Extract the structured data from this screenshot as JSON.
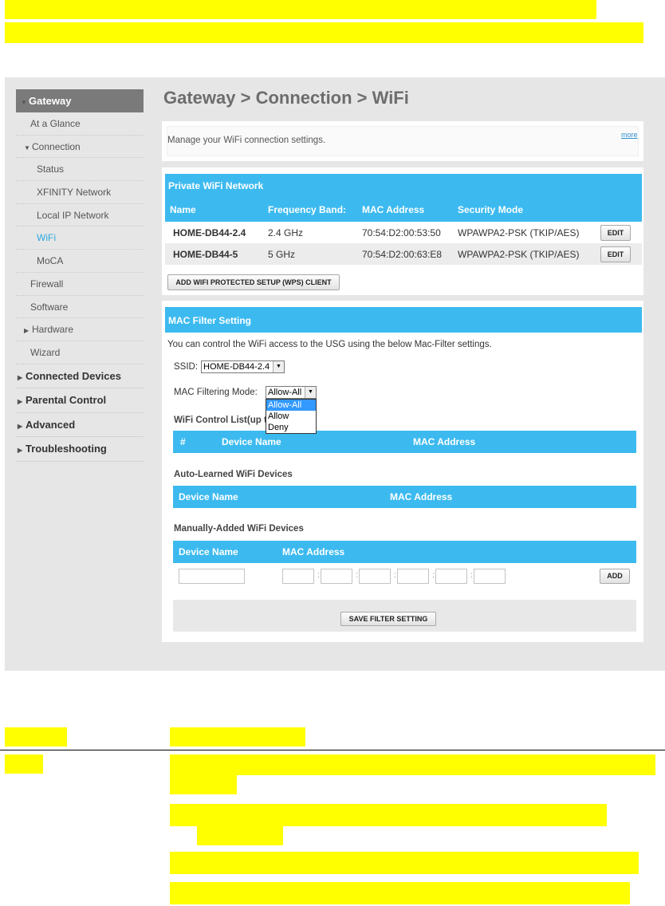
{
  "breadcrumb": "Gateway > Connection > WiFi",
  "sidebar": {
    "section": "Gateway",
    "items": [
      {
        "label": "At a Glance"
      },
      {
        "label": "Connection"
      },
      {
        "label": "Status"
      },
      {
        "label": "XFINITY Network"
      },
      {
        "label": "Local IP Network"
      },
      {
        "label": "WiFi"
      },
      {
        "label": "MoCA"
      },
      {
        "label": "Firewall"
      },
      {
        "label": "Software"
      },
      {
        "label": "Hardware"
      },
      {
        "label": "Wizard"
      }
    ],
    "top_items": [
      {
        "label": "Connected Devices"
      },
      {
        "label": "Parental Control"
      },
      {
        "label": "Advanced"
      },
      {
        "label": "Troubleshooting"
      }
    ]
  },
  "intro": {
    "text": "Manage your WiFi connection settings.",
    "more": "more"
  },
  "private_wifi": {
    "title": "Private WiFi Network",
    "columns": [
      "Name",
      "Frequency Band:",
      "MAC Address",
      "Security Mode"
    ],
    "rows": [
      {
        "name": "HOME-DB44-2.4",
        "band": "2.4 GHz",
        "mac": "70:54:D2:00:53:50",
        "security": "WPAWPA2-PSK (TKIP/AES)",
        "edit": "EDIT"
      },
      {
        "name": "HOME-DB44-5",
        "band": "5 GHz",
        "mac": "70:54:D2:00:63:E8",
        "security": "WPAWPA2-PSK (TKIP/AES)",
        "edit": "EDIT"
      }
    ],
    "wps_button": "ADD WIFI PROTECTED SETUP (WPS) CLIENT"
  },
  "mac_filter": {
    "title": "MAC Filter Setting",
    "description": "You can control the WiFi access to the USG using the below Mac-Filter settings.",
    "ssid_label": "SSID:",
    "ssid_value": "HOME-DB44-2.4",
    "mode_label": "MAC Filtering Mode:",
    "mode_value": "Allow-All",
    "mode_options": [
      "Allow-All",
      "Allow",
      "Deny"
    ],
    "control_list_label": "WiFi Control List(up t",
    "control_columns": [
      "#",
      "Device Name",
      "MAC Address"
    ],
    "auto_label": "Auto-Learned WiFi Devices",
    "auto_columns": [
      "Device Name",
      "MAC Address"
    ],
    "manual_label": "Manually-Added WiFi Devices",
    "manual_columns": [
      "Device Name",
      "MAC Address"
    ],
    "add_button": "ADD",
    "save_button": "SAVE FILTER SETTING"
  },
  "colors": {
    "accent": "#3cbaf0",
    "highlight": "#ffff00",
    "active_link": "#2ea9df"
  }
}
